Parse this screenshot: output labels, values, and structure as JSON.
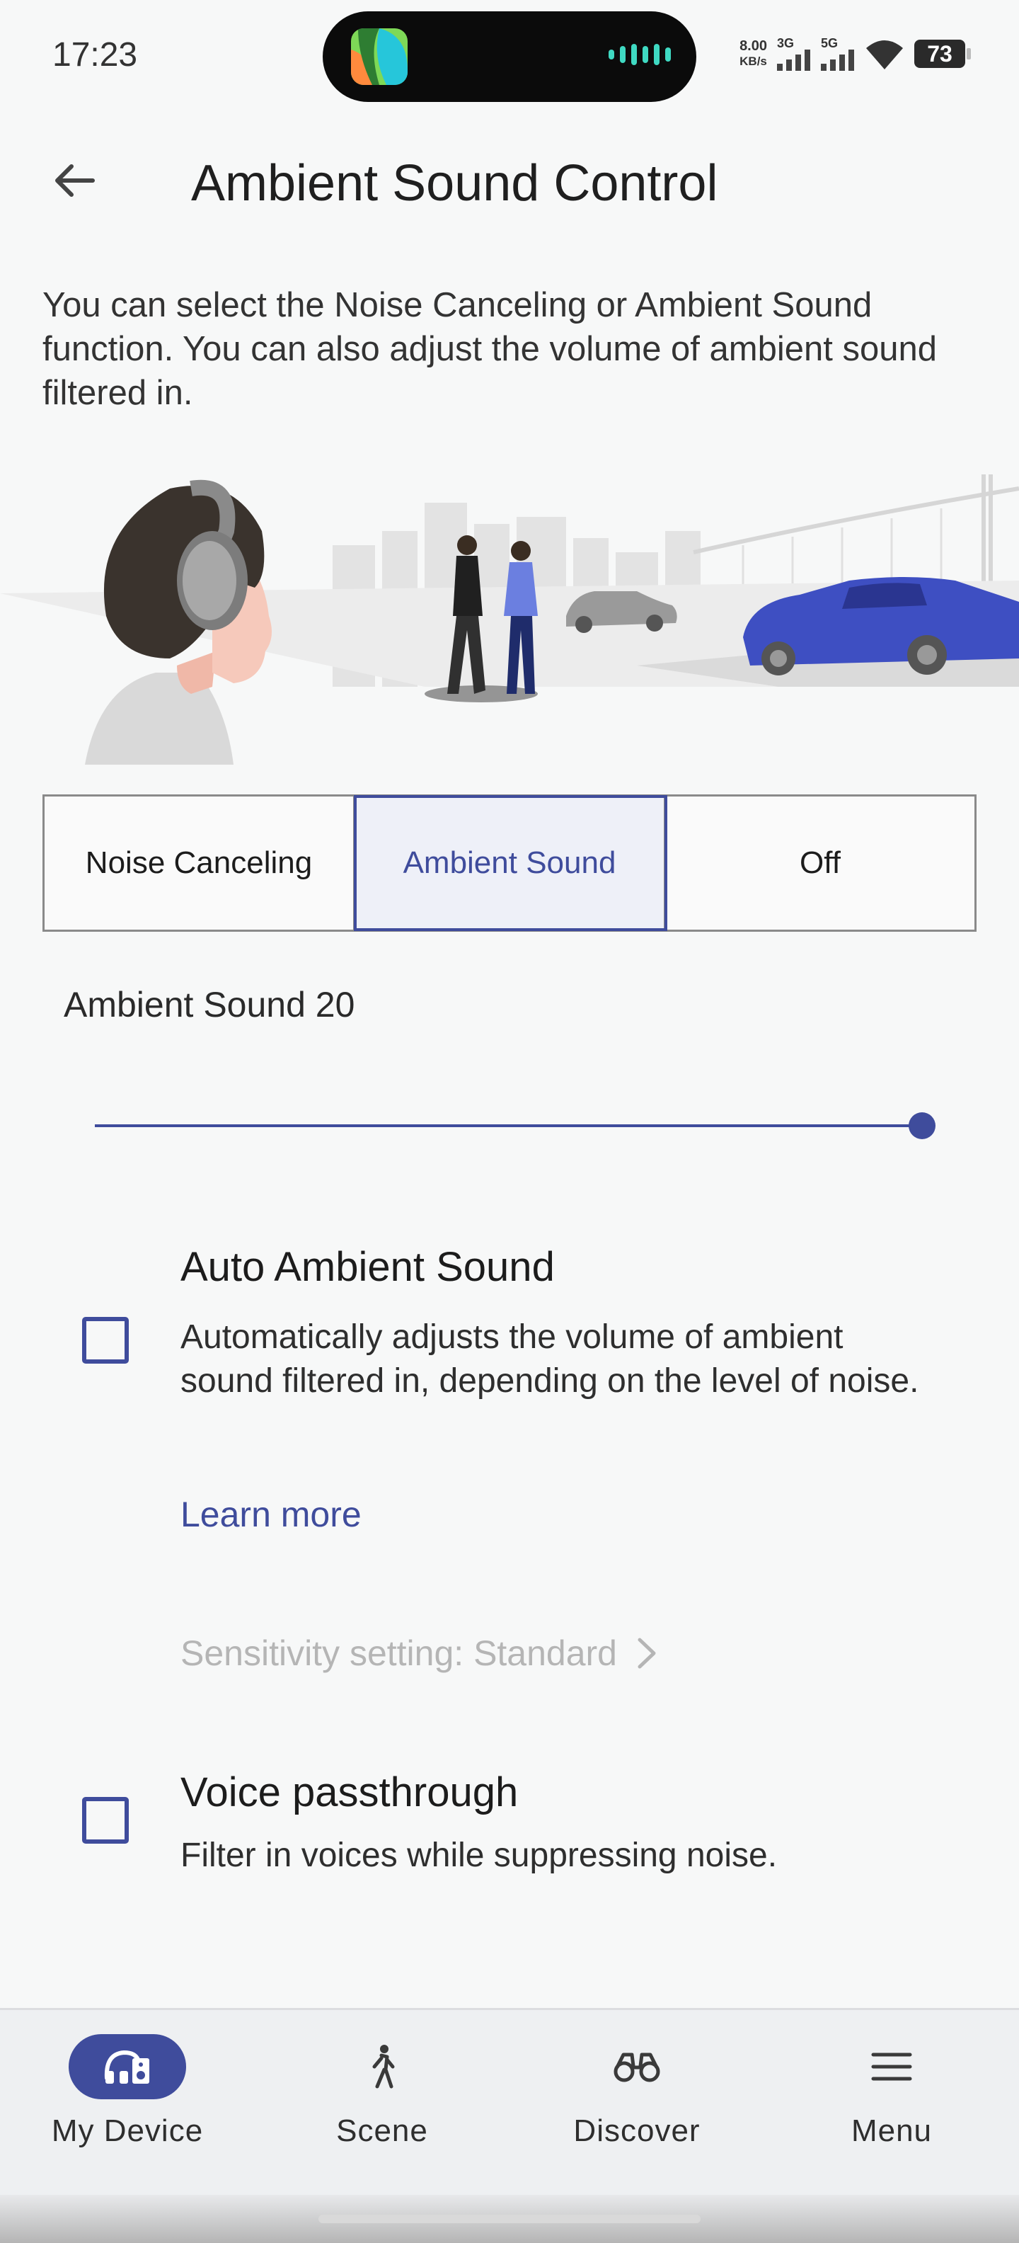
{
  "status_bar": {
    "time": "17:23",
    "net_speed_value": "8.00",
    "net_speed_unit": "KB/s",
    "signal_1_label": "3G",
    "signal_2_label": "5G",
    "battery": "73"
  },
  "header": {
    "title": "Ambient Sound Control"
  },
  "description": "You can select the Noise Canceling or Ambient Sound function. You can also adjust the volume of ambient sound filtered in.",
  "mode_selector": {
    "options": [
      "Noise Canceling",
      "Ambient Sound",
      "Off"
    ],
    "selected": "Ambient Sound"
  },
  "ambient_level": {
    "label": "Ambient Sound 20",
    "value": 20,
    "max": 20
  },
  "auto_ambient": {
    "title": "Auto Ambient Sound",
    "description": "Automatically adjusts the volume of ambient sound filtered in, depending on the level of noise.",
    "checked": false,
    "learn_more": "Learn more",
    "sensitivity": "Sensitivity setting: Standard"
  },
  "voice_passthrough": {
    "title": "Voice passthrough",
    "description": "Filter in voices while suppressing noise.",
    "checked": false
  },
  "bottom_nav": {
    "items": [
      {
        "label": "My Device",
        "icon": "headphones-device-icon",
        "active": true
      },
      {
        "label": "Scene",
        "icon": "walking-person-icon",
        "active": false
      },
      {
        "label": "Discover",
        "icon": "binoculars-icon",
        "active": false
      },
      {
        "label": "Menu",
        "icon": "hamburger-menu-icon",
        "active": false
      }
    ]
  },
  "colors": {
    "accent": "#3f4c9c",
    "background": "#f7f8f8",
    "disabled_text": "#b5b5b5"
  }
}
